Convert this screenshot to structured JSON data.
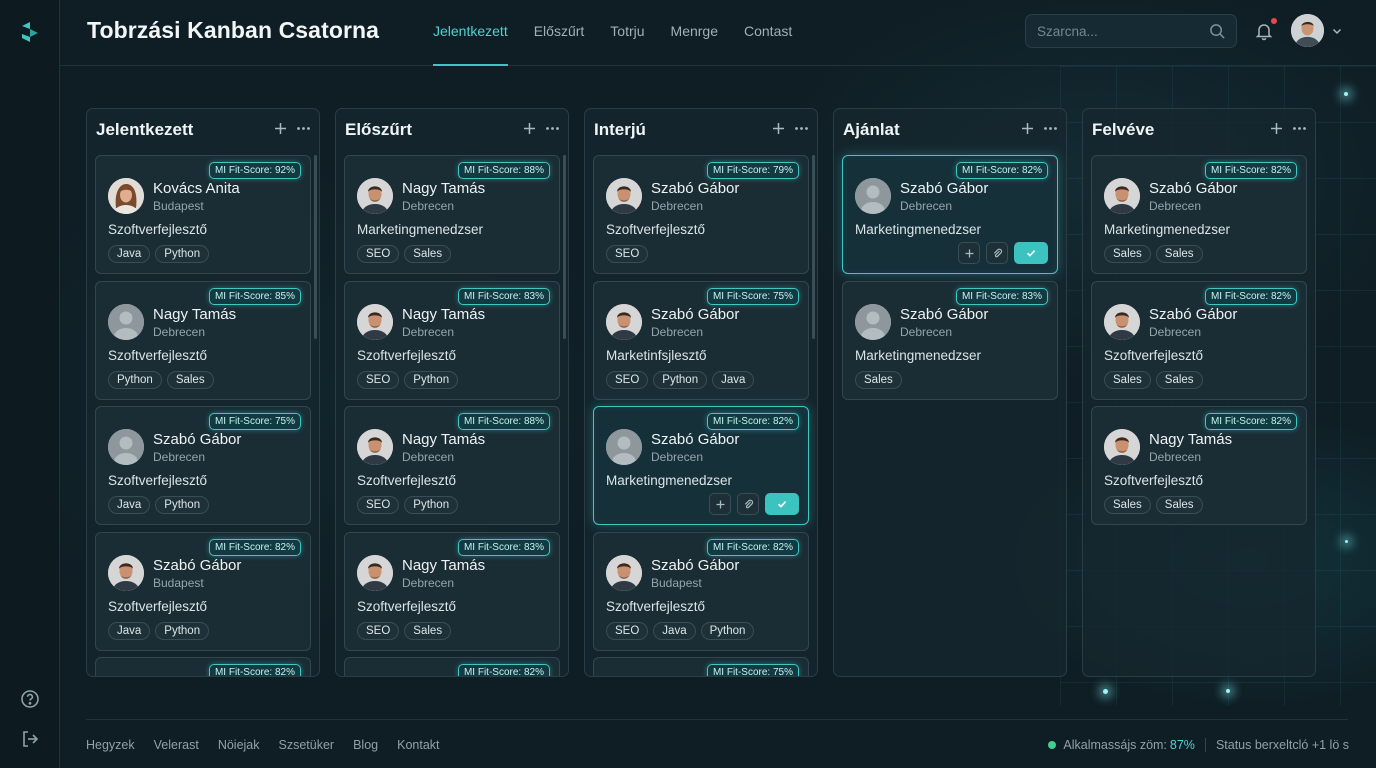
{
  "app": {
    "title": "Tobrzási Kanban Csatorna"
  },
  "nav": [
    {
      "label": "Jelentkezett",
      "active": true
    },
    {
      "label": "Előszűrt"
    },
    {
      "label": "Totrju"
    },
    {
      "label": "Menrge"
    },
    {
      "label": "Contast"
    }
  ],
  "search": {
    "placeholder": "Szarcna..."
  },
  "columns": [
    {
      "title": "Jelentkezett",
      "cards": [
        {
          "score": "MI Fit-Score: 92%",
          "name": "Kovács Anita",
          "city": "Budapest",
          "role": "Szoftverfejlesztő",
          "tags": [
            "Java",
            "Python"
          ],
          "avatar": "female-photo"
        },
        {
          "score": "MI Fit-Score: 85%",
          "name": "Nagy Tamás",
          "city": "Debrecen",
          "role": "Szoftverfejlesztő",
          "tags": [
            "Python",
            "Sales"
          ],
          "avatar": "placeholder"
        },
        {
          "score": "MI Fit-Score: 75%",
          "name": "Szabó Gábor",
          "city": "Debrecen",
          "role": "Szoftverfejlesztő",
          "tags": [
            "Java",
            "Python"
          ],
          "avatar": "placeholder"
        },
        {
          "score": "MI Fit-Score: 82%",
          "name": "Szabó Gábor",
          "city": "Budapest",
          "role": "Szoftverfejlesztő",
          "tags": [
            "Java",
            "Python"
          ],
          "avatar": "male-photo"
        },
        {
          "score": "MI Fit-Score: 82%"
        }
      ]
    },
    {
      "title": "Előszűrt",
      "cards": [
        {
          "score": "MI Fit-Score: 88%",
          "name": "Nagy Tamás",
          "city": "Debrecen",
          "role": "Marketingmenedzser",
          "tags": [
            "SEO",
            "Sales"
          ],
          "avatar": "male-photo"
        },
        {
          "score": "MI Fit-Score: 83%",
          "name": "Nagy Tamás",
          "city": "Debrecen",
          "role": "Szoftverfejlesztő",
          "tags": [
            "SEO",
            "Python"
          ],
          "avatar": "male-photo"
        },
        {
          "score": "MI Fit-Score: 88%",
          "name": "Nagy Tamás",
          "city": "Debrecen",
          "role": "Szoftverfejlesztő",
          "tags": [
            "SEO",
            "Python"
          ],
          "avatar": "male-photo"
        },
        {
          "score": "MI Fit-Score: 83%",
          "name": "Nagy Tamás",
          "city": "Debrecen",
          "role": "Szoftverfejlesztő",
          "tags": [
            "SEO",
            "Sales"
          ],
          "avatar": "male-photo"
        },
        {
          "score": "MI Fit-Score: 82%"
        }
      ]
    },
    {
      "title": "Interjú",
      "cards": [
        {
          "score": "MI Fit-Score: 79%",
          "name": "Szabó Gábor",
          "city": "Debrecen",
          "role": "Szoftverfejlesztő",
          "tags": [
            "SEO"
          ],
          "avatar": "male-photo"
        },
        {
          "score": "MI Fit-Score: 75%",
          "name": "Szabó Gábor",
          "city": "Debrecen",
          "role": "Marketinfsjlesztő",
          "tags": [
            "SEO",
            "Python",
            "Java"
          ],
          "avatar": "male-photo"
        },
        {
          "score": "MI Fit-Score: 82%",
          "name": "Szabó Gábor",
          "city": "Debrecen",
          "role": "Marketingmenedzser",
          "tags": [],
          "avatar": "placeholder",
          "highlight": true
        },
        {
          "score": "MI Fit-Score: 82%",
          "name": "Szabó Gábor",
          "city": "Budapest",
          "role": "Szoftverfejlesztő",
          "tags": [
            "SEO",
            "Java",
            "Python"
          ],
          "avatar": "male-photo"
        },
        {
          "score": "MI Fit-Score: 75%"
        }
      ]
    },
    {
      "title": "Ajánlat",
      "cards": [
        {
          "score": "MI Fit-Score: 82%",
          "name": "Szabó Gábor",
          "city": "Debrecen",
          "role": "Marketingmenedzser",
          "tags": [],
          "avatar": "placeholder",
          "highlight": true
        },
        {
          "score": "MI Fit-Score: 83%",
          "name": "Szabó Gábor",
          "city": "Debrecen",
          "role": "Marketingmenedzser",
          "tags": [
            "Sales"
          ],
          "avatar": "placeholder"
        }
      ]
    },
    {
      "title": "Felvéve",
      "cards": [
        {
          "score": "MI Fit-Score: 82%",
          "name": "Szabó Gábor",
          "city": "Debrecen",
          "role": "Marketingmenedzser",
          "tags": [
            "Sales",
            "Sales"
          ],
          "avatar": "male-photo"
        },
        {
          "score": "MI Fit-Score: 82%",
          "name": "Szabó Gábor",
          "city": "Debrecen",
          "role": "Szoftverfejlesztő",
          "tags": [
            "Sales",
            "Sales"
          ],
          "avatar": "male-photo"
        },
        {
          "score": "MI Fit-Score: 82%",
          "name": "Nagy Tamás",
          "city": "Debrecen",
          "role": "Szoftverfejlesztő",
          "tags": [
            "Sales",
            "Sales"
          ],
          "avatar": "male-photo"
        }
      ]
    }
  ],
  "footer": {
    "links": [
      "Hegyzek",
      "Velerast",
      "Nöiejak",
      "Szsetüker",
      "Blog",
      "Kontakt"
    ],
    "status_label": "Alkalmassájs zöm:",
    "status_value": "87%",
    "status_note": "Status berxeltcló +1 lö s"
  },
  "colors": {
    "accent": "#3fc7c3",
    "background": "#0f1d24",
    "status": "#3fd08e"
  }
}
